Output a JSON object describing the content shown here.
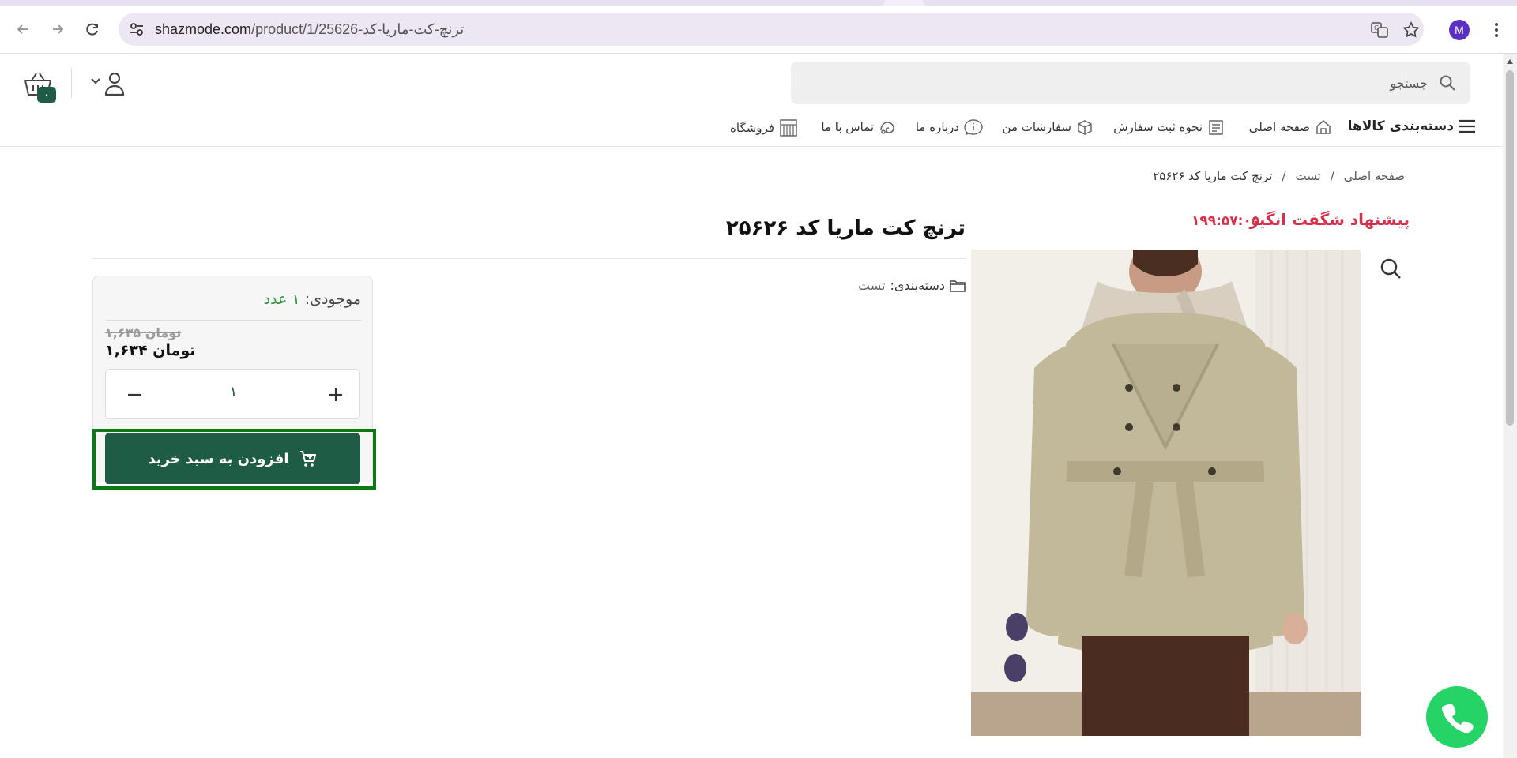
{
  "browser": {
    "url_host": "shazmode.com",
    "url_path": "/product/1/25626-ترنچ-کت-ماریا-کد",
    "profile_initial": "M"
  },
  "header": {
    "search_placeholder": "جستجو",
    "cart_count": "۰"
  },
  "nav": {
    "categories": "دسته‌بندی کالاها",
    "home": "صفحه اصلی",
    "how_to_order": "نحوه ثبت سفارش",
    "my_orders": "سفارشات من",
    "about": "درباره ما",
    "contact": "تماس با ما",
    "store": "فروشگاه"
  },
  "breadcrumb": {
    "items": [
      "صفحه اصلی",
      "تست",
      "ترنچ کت ماریا کد ۲۵۶۲۶"
    ],
    "separator": "/"
  },
  "offer": {
    "title": "پیشنهاد شگفت انگیز",
    "timer": "۱۹۹:۵۷:۰۵"
  },
  "product": {
    "title": "ترنچ کت ماریا کد ۲۵۶۲۶",
    "category_label": "دسته‌بندی:",
    "category_value": "تست",
    "image_alt": "ترنچ کت ماریا"
  },
  "buy_box": {
    "stock_label": "موجودی:",
    "stock_value": "۱ عدد",
    "old_price": "۱,۶۳۵ تومان",
    "new_price": "۱,۶۳۴ تومان",
    "quantity": "۱",
    "add_to_cart": "افزودن به سبد خرید"
  },
  "colors": {
    "brand_green": "#1e5c45",
    "offer_red": "#d6304a",
    "highlight_green": "#0b7a14",
    "whatsapp": "#25d366"
  }
}
